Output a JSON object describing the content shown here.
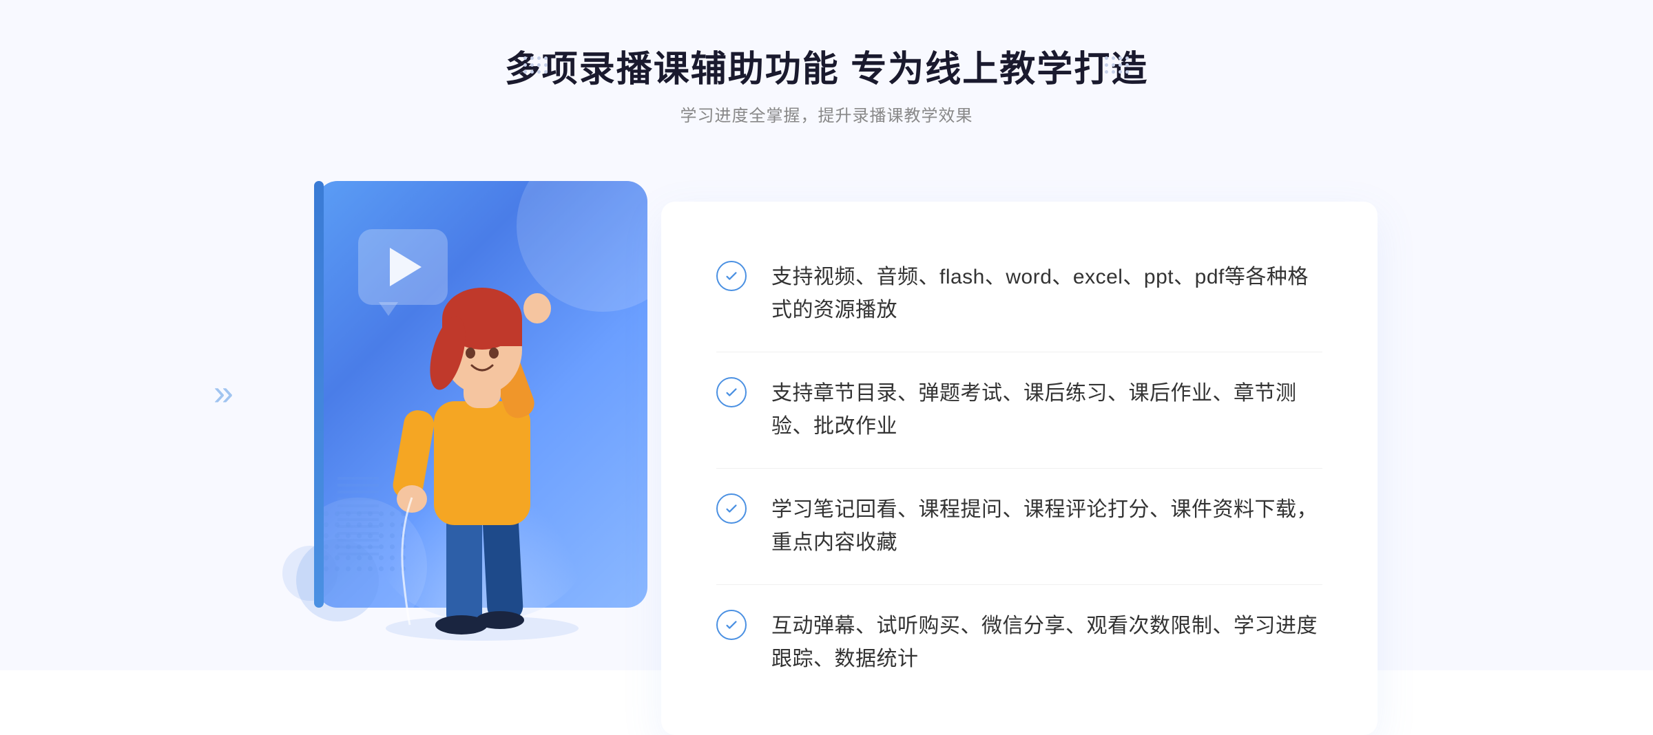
{
  "header": {
    "main_title": "多项录播课辅助功能 专为线上教学打造",
    "sub_title": "学习进度全掌握，提升录播课教学效果"
  },
  "features": [
    {
      "id": "feature-1",
      "text": "支持视频、音频、flash、word、excel、ppt、pdf等各种格式的资源播放"
    },
    {
      "id": "feature-2",
      "text": "支持章节目录、弹题考试、课后练习、课后作业、章节测验、批改作业"
    },
    {
      "id": "feature-3",
      "text": "学习笔记回看、课程提问、课程评论打分、课件资料下载，重点内容收藏"
    },
    {
      "id": "feature-4",
      "text": "互动弹幕、试听购买、微信分享、观看次数限制、学习进度跟踪、数据统计"
    }
  ],
  "colors": {
    "primary_blue": "#4a90e2",
    "title_dark": "#1a1a2e",
    "text_gray": "#888888",
    "text_body": "#333333",
    "bg_light": "#f8f9ff",
    "white": "#ffffff"
  },
  "decorations": {
    "chevron": "«",
    "dots_label": "decorative dots"
  }
}
